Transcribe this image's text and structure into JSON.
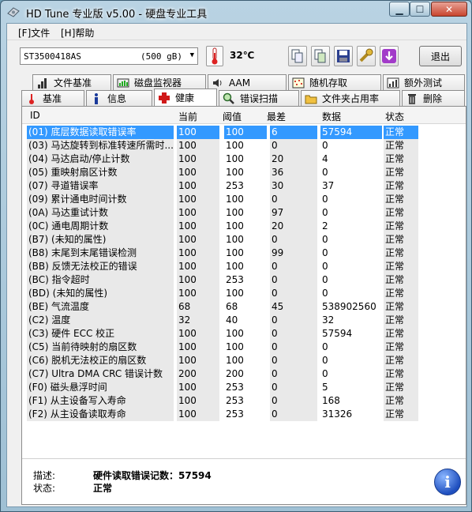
{
  "window": {
    "title": "HD Tune 专业版 v5.00 - 硬盘专业工具"
  },
  "menu": {
    "file": "[F]文件",
    "help": "[H]帮助"
  },
  "toolbar": {
    "drive_model": "ST3500418AS",
    "drive_size": "(500 gB)",
    "temperature": "32℃",
    "exit_label": "退出"
  },
  "tabs_top": [
    {
      "label": "文件基准",
      "icon": "file-benchmark-icon"
    },
    {
      "label": "磁盘监视器",
      "icon": "disk-monitor-icon"
    },
    {
      "label": "AAM",
      "icon": "speaker-icon"
    },
    {
      "label": "随机存取",
      "icon": "random-access-icon"
    },
    {
      "label": "额外测试",
      "icon": "extra-tests-icon"
    }
  ],
  "tabs_bottom": [
    {
      "label": "基准",
      "icon": "benchmark-icon"
    },
    {
      "label": "信息",
      "icon": "info-icon"
    },
    {
      "label": "健康",
      "icon": "health-cross-icon",
      "active": true
    },
    {
      "label": "错误扫描",
      "icon": "magnifier-icon"
    },
    {
      "label": "文件夹占用率",
      "icon": "folder-icon"
    },
    {
      "label": "删除",
      "icon": "trash-icon"
    }
  ],
  "table": {
    "headers": [
      "ID",
      "当前",
      "阈值",
      "最差",
      "数据",
      "状态"
    ],
    "rows": [
      [
        "(01) 底层数据读取错误率",
        "100",
        "100",
        "6",
        "57594",
        "正常"
      ],
      [
        "(03) 马达旋转到标准转速所需时...",
        "100",
        "100",
        "0",
        "0",
        "正常"
      ],
      [
        "(04) 马达启动/停止计数",
        "100",
        "100",
        "20",
        "4",
        "正常"
      ],
      [
        "(05) 重映射扇区计数",
        "100",
        "100",
        "36",
        "0",
        "正常"
      ],
      [
        "(07) 寻道错误率",
        "100",
        "253",
        "30",
        "37",
        "正常"
      ],
      [
        "(09) 累计通电时间计数",
        "100",
        "100",
        "0",
        "0",
        "正常"
      ],
      [
        "(0A) 马达重试计数",
        "100",
        "100",
        "97",
        "0",
        "正常"
      ],
      [
        "(0C) 通电周期计数",
        "100",
        "100",
        "20",
        "2",
        "正常"
      ],
      [
        "(B7) (未知的属性)",
        "100",
        "100",
        "0",
        "0",
        "正常"
      ],
      [
        "(B8) 末尾到末尾错误检测",
        "100",
        "100",
        "99",
        "0",
        "正常"
      ],
      [
        "(BB) 反馈无法校正的错误",
        "100",
        "100",
        "0",
        "0",
        "正常"
      ],
      [
        "(BC) 指令超时",
        "100",
        "253",
        "0",
        "0",
        "正常"
      ],
      [
        "(BD) (未知的属性)",
        "100",
        "100",
        "0",
        "0",
        "正常"
      ],
      [
        "(BE) 气流温度",
        "68",
        "68",
        "45",
        "538902560",
        "正常"
      ],
      [
        "(C2) 温度",
        "32",
        "40",
        "0",
        "32",
        "正常"
      ],
      [
        "(C3) 硬件 ECC 校正",
        "100",
        "100",
        "0",
        "57594",
        "正常"
      ],
      [
        "(C5) 当前待映射的扇区数",
        "100",
        "100",
        "0",
        "0",
        "正常"
      ],
      [
        "(C6) 脱机无法校正的扇区数",
        "100",
        "100",
        "0",
        "0",
        "正常"
      ],
      [
        "(C7) Ultra DMA CRC 错误计数",
        "200",
        "200",
        "0",
        "0",
        "正常"
      ],
      [
        "(F0) 磁头悬浮时间",
        "100",
        "253",
        "0",
        "5",
        "正常"
      ],
      [
        "(F1) 从主设备写入寿命",
        "100",
        "253",
        "0",
        "168",
        "正常"
      ],
      [
        "(F2) 从主设备读取寿命",
        "100",
        "253",
        "0",
        "31326",
        "正常"
      ]
    ]
  },
  "footer": {
    "desc_label": "描述:",
    "desc_value": "硬件读取错误记数：57594",
    "status_label": "状态:",
    "status_value": "正常"
  },
  "colors": {
    "selection": "#3399ff",
    "column_shade": "#e9e9e9"
  }
}
